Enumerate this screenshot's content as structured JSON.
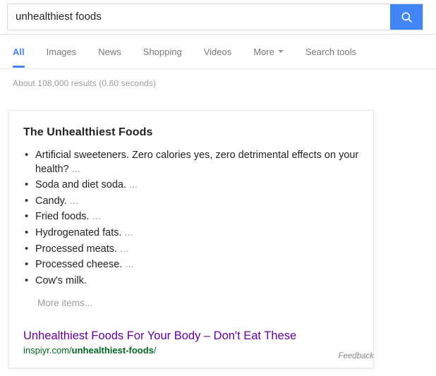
{
  "search": {
    "value": "unhealthiest foods",
    "placeholder": "Search",
    "button_label": "Search",
    "button_icon": "search-icon",
    "button_color": "#4285f4"
  },
  "nav": {
    "items": [
      {
        "label": "All",
        "selected": true
      },
      {
        "label": "Images",
        "selected": false
      },
      {
        "label": "News",
        "selected": false
      },
      {
        "label": "Shopping",
        "selected": false
      },
      {
        "label": "Videos",
        "selected": false
      },
      {
        "label": "More",
        "selected": false,
        "icon": "chevron-down-icon"
      },
      {
        "label": "Search tools",
        "selected": false
      }
    ],
    "accent_color": "#4285f4",
    "inactive_color": "#777777"
  },
  "results": {
    "stats": "About 108,000 results (0.60 seconds)",
    "answer_card": {
      "title": "The Unhealthiest Foods",
      "items": [
        {
          "text": "Artificial sweeteners. Zero calories yes, zero detrimental effects on your health?",
          "ellipsis": "..."
        },
        {
          "text": "Soda and diet soda.",
          "ellipsis": "..."
        },
        {
          "text": "Candy.",
          "ellipsis": "..."
        },
        {
          "text": "Fried foods.",
          "ellipsis": "..."
        },
        {
          "text": "Hydrogenated fats.",
          "ellipsis": "..."
        },
        {
          "text": "Processed meats.",
          "ellipsis": "..."
        },
        {
          "text": "Processed cheese.",
          "ellipsis": "..."
        },
        {
          "text": "Cow's milk.",
          "ellipsis": ""
        }
      ],
      "more_items": "More items...",
      "source": {
        "title": "Unhealthiest Foods For Your Body – Don't Eat These",
        "title_color": "#660099",
        "url_prefix": "inspiyr.com/",
        "url_bold": "unhealthiest-foods",
        "url_suffix": "/",
        "url_color": "#006621"
      }
    },
    "feedback_label": "Feedback"
  }
}
